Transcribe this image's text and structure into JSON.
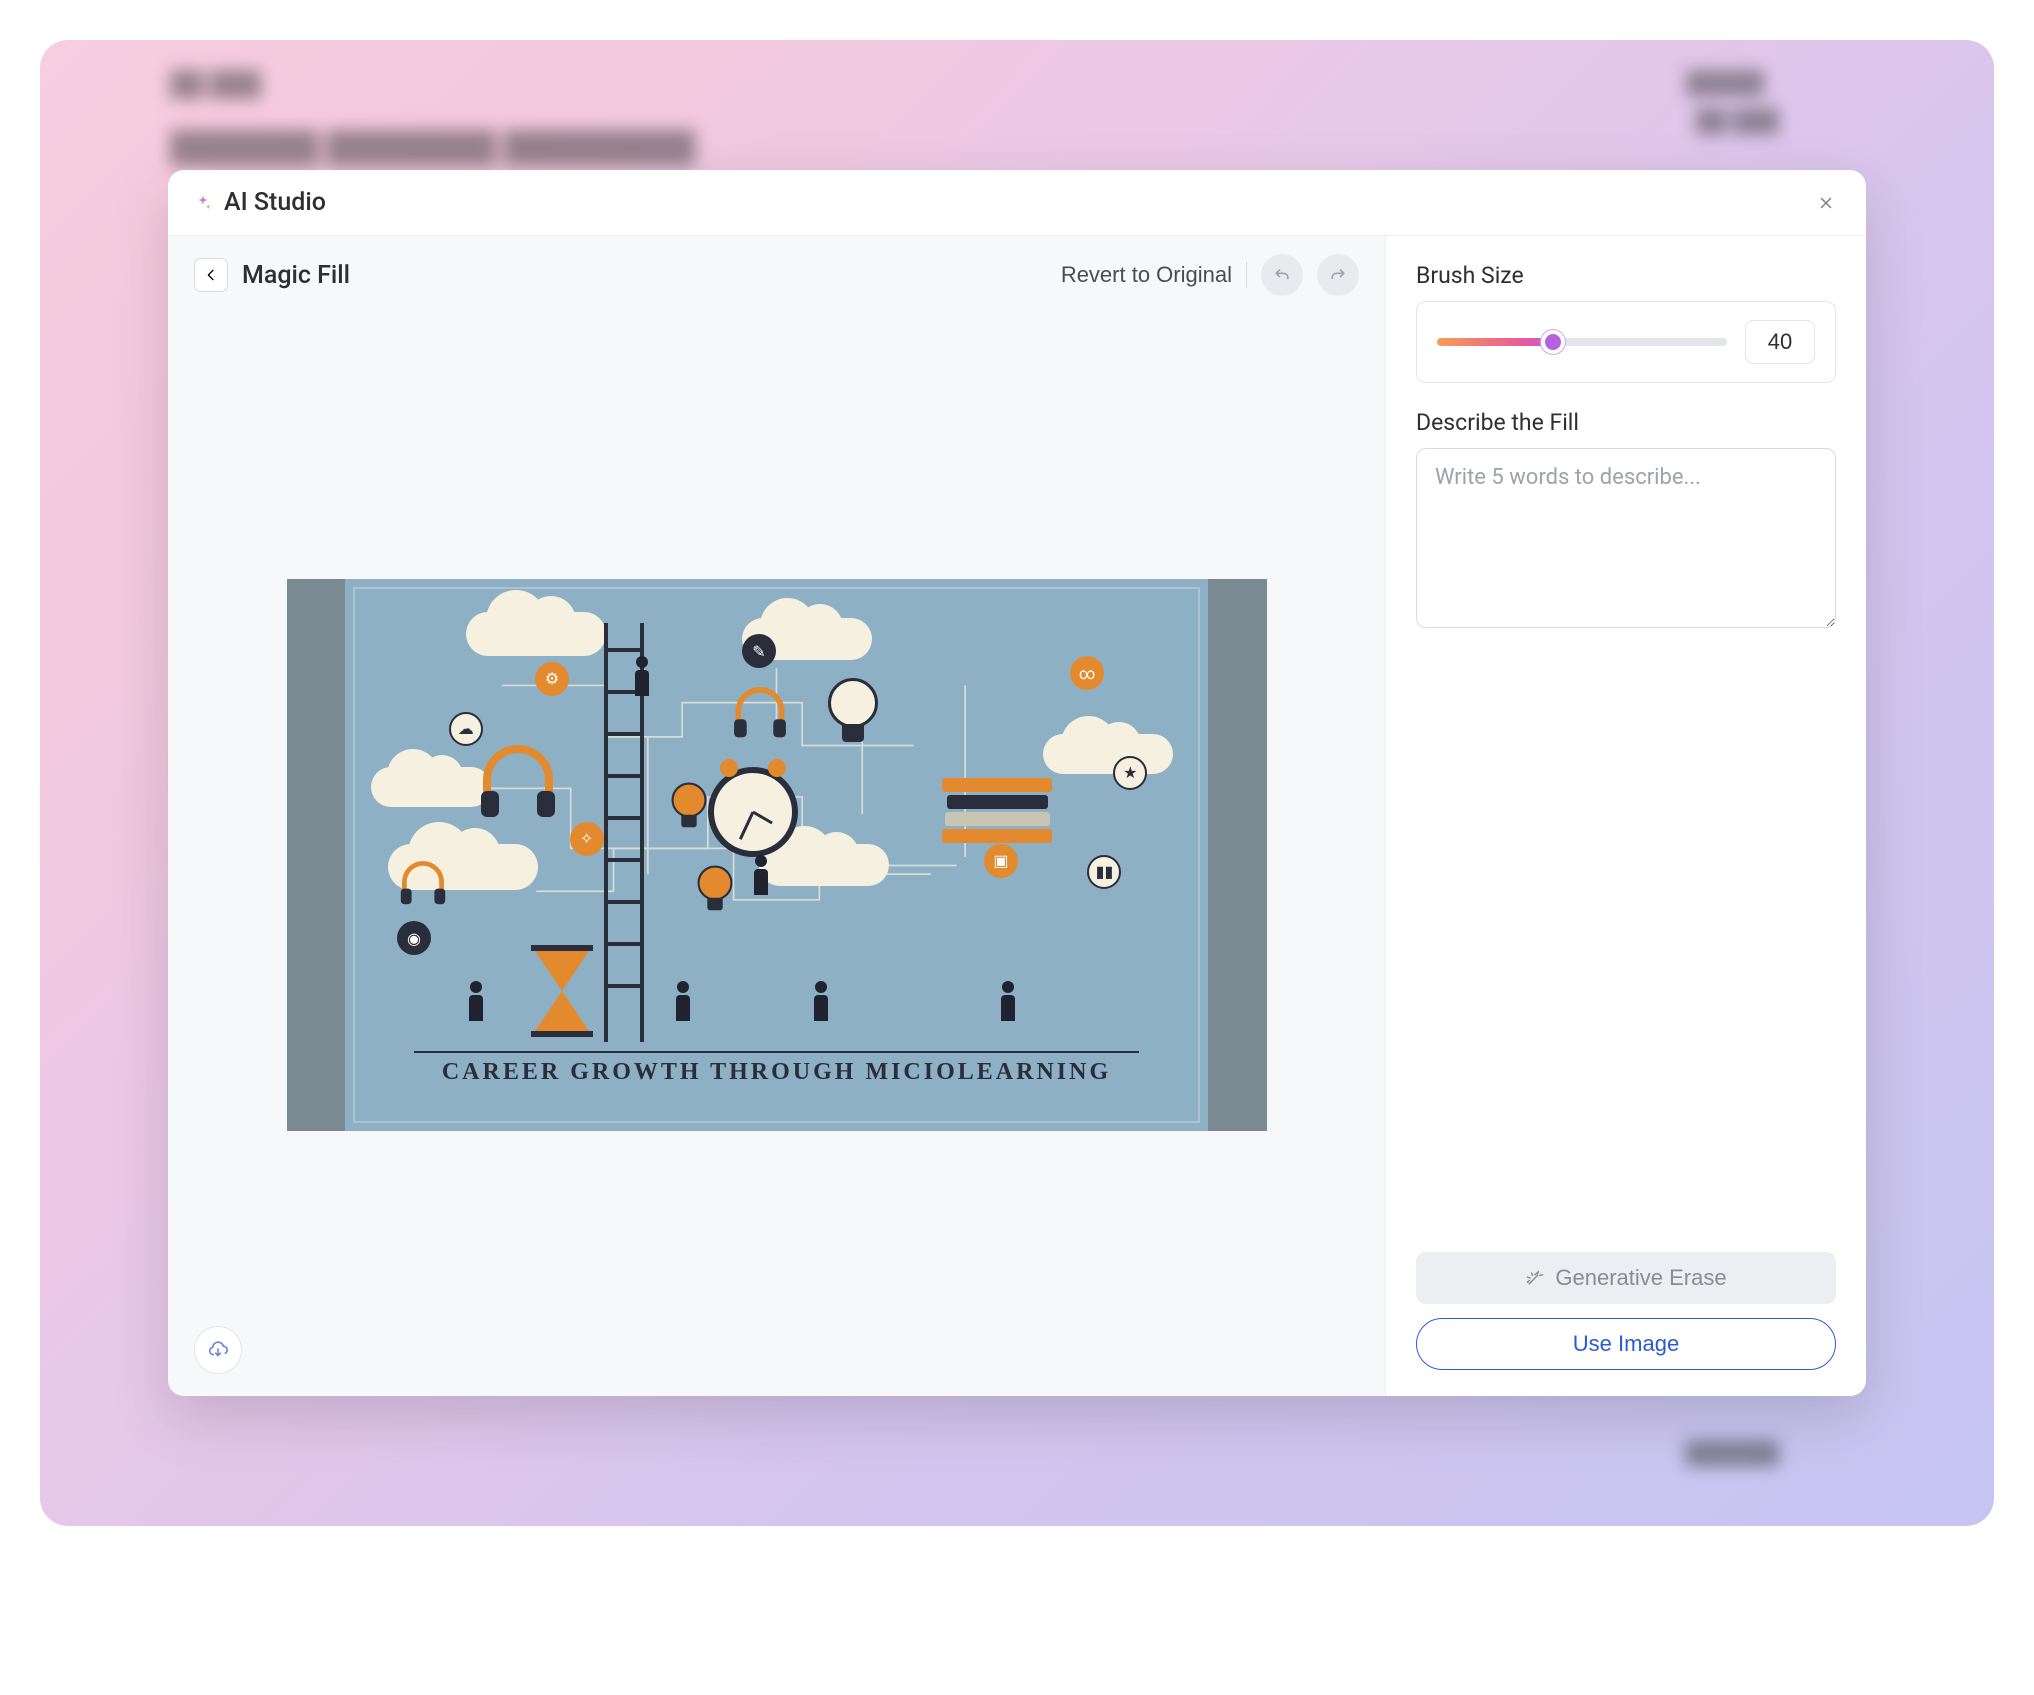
{
  "header": {
    "title": "AI Studio"
  },
  "toolbar": {
    "tool_title": "Magic Fill",
    "revert_label": "Revert to Original"
  },
  "controls": {
    "brush_label": "Brush Size",
    "brush_value": "40",
    "describe_label": "Describe the Fill",
    "describe_placeholder": "Write 5 words to describe...",
    "generative_erase_label": "Generative Erase",
    "use_image_label": "Use Image"
  },
  "illustration": {
    "banner_text": "CAREER GROWTH THROUGH MICIOLEARNING"
  }
}
